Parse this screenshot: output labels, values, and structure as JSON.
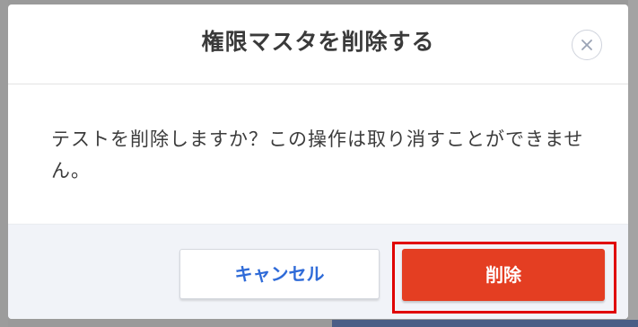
{
  "dialog": {
    "title": "権限マスタを削除する",
    "message": "テストを削除しますか？この操作は取り消すことができません。",
    "close_icon": "close-icon"
  },
  "buttons": {
    "cancel_label": "キャンセル",
    "delete_label": "削除",
    "delete_color": "#e43e22",
    "cancel_text_color": "#2f6bd8"
  },
  "highlight": {
    "color": "#e00000"
  }
}
